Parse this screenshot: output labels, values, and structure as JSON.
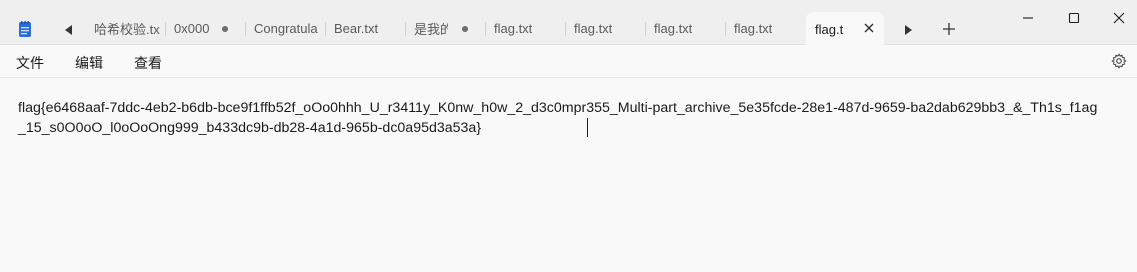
{
  "tabs": [
    {
      "label": "哈希校验.tx",
      "modified": false
    },
    {
      "label": "0x000",
      "modified": true
    },
    {
      "label": "Congratula",
      "modified": false
    },
    {
      "label": "Bear.txt",
      "modified": false
    },
    {
      "label": "是我的",
      "modified": true
    },
    {
      "label": "flag.txt",
      "modified": false
    },
    {
      "label": "flag.txt",
      "modified": false
    },
    {
      "label": "flag.txt",
      "modified": false
    },
    {
      "label": "flag.txt",
      "modified": false
    },
    {
      "label": "flag.t",
      "active": true
    }
  ],
  "menu": {
    "file": "文件",
    "edit": "编辑",
    "view": "查看"
  },
  "editor": {
    "content": "flag{e6468aaf-7ddc-4eb2-b6db-bce9f1ffb52f_oOo0hhh_U_r3411y_K0nw_h0w_2_d3c0mpr355_Multi-part_archive_5e35fcde-28e1-487d-9659-ba2dab629bb3_&_Th1s_f1ag_15_s0O0oO_l0oOoOng999_b433dc9b-db28-4a1d-965b-dc0a95d3a53a}"
  },
  "icons": {
    "app": "notepad-icon",
    "scroll_left": "chevron-left-icon",
    "scroll_right": "chevron-right-icon",
    "new_tab": "plus-icon",
    "close_tab": "close-icon",
    "minimize": "minimize-icon",
    "maximize": "maximize-icon",
    "close_window": "close-icon",
    "settings": "gear-icon"
  },
  "colors": {
    "app_icon": "#2b6cd6",
    "background": "#f9f9f9",
    "titlebar": "#f0efef"
  }
}
